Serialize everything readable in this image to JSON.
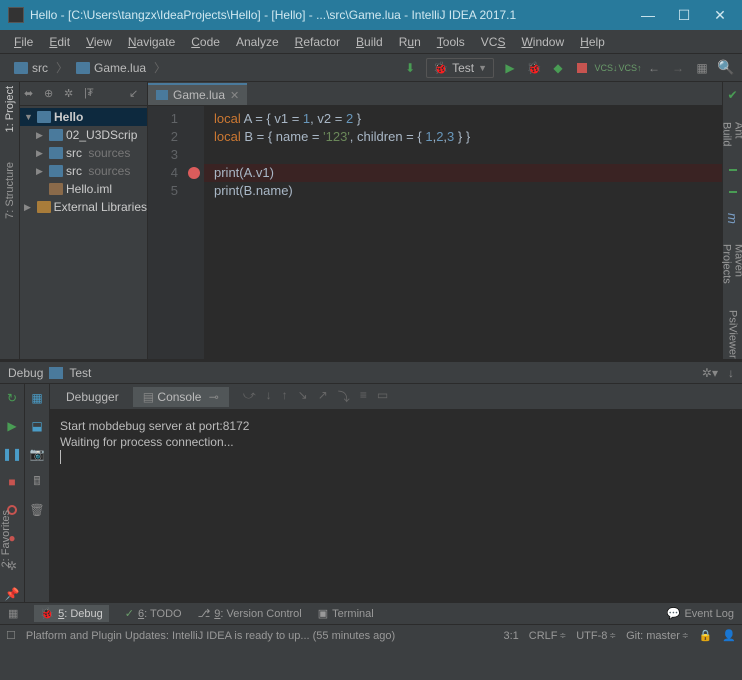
{
  "title": "Hello - [C:\\Users\\tangzx\\IdeaProjects\\Hello] - [Hello] - ...\\src\\Game.lua - IntelliJ IDEA 2017.1",
  "menu": [
    "File",
    "Edit",
    "View",
    "Navigate",
    "Code",
    "Analyze",
    "Refactor",
    "Build",
    "Run",
    "Tools",
    "VCS",
    "Window",
    "Help"
  ],
  "menu_underline": [
    "F",
    "E",
    "V",
    "N",
    "C",
    "",
    "R",
    "B",
    "u",
    "T",
    "S",
    "W",
    "H"
  ],
  "breadcrumb": {
    "root": "src",
    "file": "Game.lua"
  },
  "run_config": {
    "label": "Test"
  },
  "left_tools": {
    "project": "1: Project",
    "structure": "7: Structure",
    "favorites": "2: Favorites"
  },
  "right_tools": {
    "ant": "Ant Build",
    "maven": "Maven Projects",
    "psi": "PsiViewer"
  },
  "project_tree": {
    "root": "Hello",
    "items": [
      {
        "label": "02_U3DScrip",
        "indent": 16
      },
      {
        "label": "src",
        "suffix": "sources",
        "indent": 16
      },
      {
        "label": "src",
        "suffix": "sources",
        "indent": 16
      },
      {
        "label": "Hello.iml",
        "indent": 16,
        "file": true
      }
    ],
    "ext_lib": "External Libraries"
  },
  "editor": {
    "tab": "Game.lua",
    "gutter": [
      "1",
      "2",
      "3",
      "4",
      "5"
    ],
    "code_lines": [
      {
        "t": [
          [
            "kw",
            "local"
          ],
          [
            "var",
            " A = { v1 = "
          ],
          [
            "num",
            "1"
          ],
          [
            "var",
            ", v2 = "
          ],
          [
            "num",
            "2"
          ],
          [
            "var",
            " }"
          ]
        ]
      },
      {
        "t": [
          [
            "kw",
            "local"
          ],
          [
            "var",
            " B = { name = "
          ],
          [
            "str",
            "'123'"
          ],
          [
            "var",
            ", children = { "
          ],
          [
            "num",
            "1"
          ],
          [
            "var",
            ","
          ],
          [
            "num",
            "2"
          ],
          [
            "var",
            ","
          ],
          [
            "num",
            "3"
          ],
          [
            "var",
            " } }"
          ]
        ]
      },
      {
        "t": []
      },
      {
        "hl": true,
        "t": [
          [
            "fn",
            "print"
          ],
          [
            "var",
            "(A.v1)"
          ]
        ]
      },
      {
        "t": [
          [
            "fn",
            "print"
          ],
          [
            "var",
            "(B.name)"
          ]
        ]
      }
    ]
  },
  "debug": {
    "title": "Debug",
    "config": "Test",
    "tabs": {
      "debugger": "Debugger",
      "console": "Console"
    },
    "console_lines": [
      "Start mobdebug server at port:8172",
      "Waiting for process connection..."
    ]
  },
  "bottom_tabs": {
    "debug": "5: Debug",
    "todo": "6: TODO",
    "vcs": "9: Version Control",
    "terminal": "Terminal",
    "eventlog": "Event Log"
  },
  "status": {
    "msg": "Platform and Plugin Updates: IntelliJ IDEA is ready to up... (55 minutes ago)",
    "pos": "3:1",
    "eol": "CRLF",
    "enc": "UTF-8",
    "git": "Git: master"
  }
}
